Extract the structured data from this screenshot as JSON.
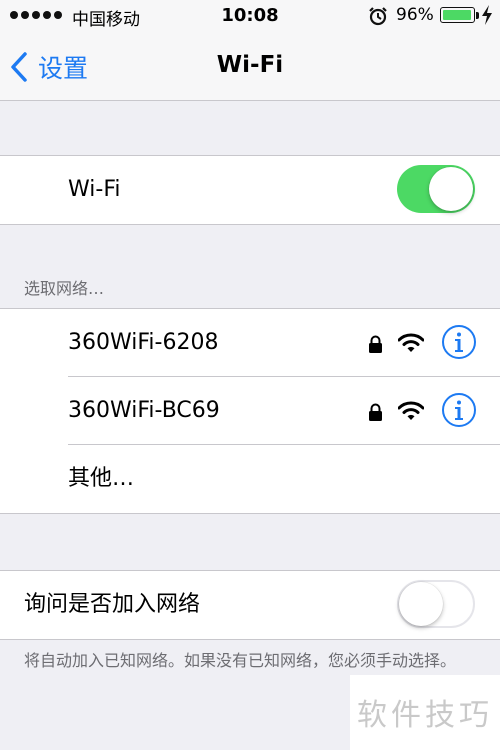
{
  "status_bar": {
    "carrier": "中国移动",
    "time": "10:08",
    "battery_percent": "96%",
    "battery_level": 0.96,
    "icons": [
      "signal-dots-icon",
      "alarm-icon",
      "battery-icon",
      "charging-bolt-icon"
    ]
  },
  "nav": {
    "back_label": "设置",
    "title": "Wi-Fi"
  },
  "wifi_toggle": {
    "label": "Wi-Fi",
    "state": "on"
  },
  "networks": {
    "header": "选取网络…",
    "items": [
      {
        "name": "360WiFi-6208",
        "secured": true
      },
      {
        "name": "360WiFi-BC69",
        "secured": true
      },
      {
        "name": "其他…"
      }
    ]
  },
  "ask_to_join": {
    "label": "询问是否加入网络",
    "state": "off",
    "footer": "将自动加入已知网络。如果没有已知网络，您必须手动选择。"
  },
  "watermark": {
    "text": "软件技巧"
  },
  "colors": {
    "accent": "#1d7af2",
    "toggle_on": "#4cd964",
    "background": "#efeff4",
    "battery": "#4cd964"
  }
}
